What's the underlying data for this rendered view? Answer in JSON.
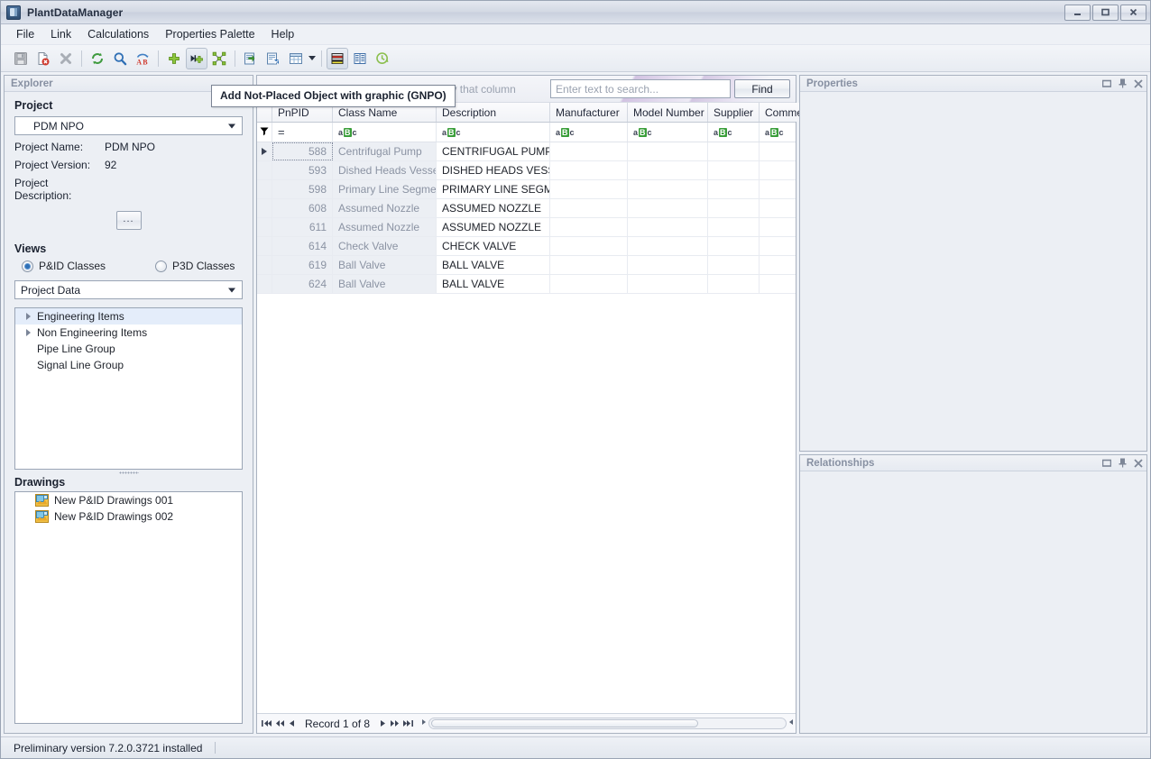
{
  "window": {
    "title": "PlantDataManager",
    "icon": "app-icon",
    "minimize_label": "Minimize",
    "maximize_label": "Maximize",
    "close_label": "Close"
  },
  "menu": {
    "items": [
      {
        "label": "File"
      },
      {
        "label": "Link"
      },
      {
        "label": "Calculations"
      },
      {
        "label": "Properties Palette"
      },
      {
        "label": "Help"
      }
    ]
  },
  "toolbar": {
    "buttons": [
      {
        "name": "save-icon",
        "tip": "Save"
      },
      {
        "name": "delete-document-icon",
        "tip": "Delete document"
      },
      {
        "name": "close-x-icon",
        "tip": "Close"
      },
      {
        "name": "refresh-icon",
        "tip": "Refresh"
      },
      {
        "name": "search-icon",
        "tip": "Search"
      },
      {
        "name": "rename-ab-icon",
        "tip": "Rename"
      },
      {
        "name": "add-plus-icon",
        "tip": "Add"
      },
      {
        "name": "add-not-placed-object-gnpo-icon",
        "tip": "Add Not-Placed Object with graphic (GNPO)"
      },
      {
        "name": "link-scatter-icon",
        "tip": "Link"
      },
      {
        "name": "export-icon",
        "tip": "Export"
      },
      {
        "name": "import-icon",
        "tip": "Import"
      },
      {
        "name": "table-layout-icon",
        "tip": "Table layout"
      },
      {
        "name": "color-bands-icon",
        "tip": "Color bands"
      },
      {
        "name": "columns-icon",
        "tip": "Columns"
      },
      {
        "name": "history-clock-icon",
        "tip": "History"
      }
    ]
  },
  "tooltip": {
    "text": "Add Not-Placed Object with graphic (GNPO)"
  },
  "explorer": {
    "title": "Explorer",
    "project_section_label": "Project",
    "project_combo_value": "PDM NPO",
    "fields": [
      {
        "label": "Project Name:",
        "value": "PDM NPO"
      },
      {
        "label": "Project Version:",
        "value": "92"
      },
      {
        "label": "Project Description:",
        "value": ""
      }
    ],
    "browse_button_label": "...",
    "views_section_label": "Views",
    "radios": [
      {
        "label": "P&ID Classes",
        "selected": true
      },
      {
        "label": "P3D Classes",
        "selected": false
      }
    ],
    "data_combo_value": "Project Data",
    "tree": [
      {
        "label": "Engineering Items",
        "expandable": true,
        "selected": true
      },
      {
        "label": "Non Engineering Items",
        "expandable": true,
        "selected": false
      },
      {
        "label": "Pipe Line Group",
        "expandable": false,
        "selected": false
      },
      {
        "label": "Signal Line Group",
        "expandable": false,
        "selected": false
      }
    ],
    "drawings_section_label": "Drawings",
    "drawings": [
      {
        "label": "New P&ID Drawings 001",
        "icon": "drawing-icon"
      },
      {
        "label": "New P&ID Drawings 002",
        "icon": "drawing-icon"
      }
    ]
  },
  "grid": {
    "group_hint": "Drag a column header here to group by that column",
    "search_placeholder": "Enter text to search...",
    "search_value": "",
    "find_label": "Find",
    "columns": [
      {
        "label": "PnPID",
        "width": 67,
        "filter": "=",
        "align": "right",
        "readonly": true
      },
      {
        "label": "Class Name",
        "width": 115,
        "filter": "abc",
        "align": "left",
        "readonly": true
      },
      {
        "label": "Description",
        "width": 126,
        "filter": "abc",
        "align": "left",
        "readonly": false
      },
      {
        "label": "Manufacturer",
        "width": 86,
        "filter": "abc",
        "align": "left",
        "readonly": false
      },
      {
        "label": "Model Number",
        "width": 89,
        "filter": "abc",
        "align": "left",
        "readonly": false
      },
      {
        "label": "Supplier",
        "width": 57,
        "filter": "abc",
        "align": "left",
        "readonly": false
      },
      {
        "label": "Comment",
        "width": 58,
        "filter": "abc",
        "align": "left",
        "readonly": false
      }
    ],
    "rows": [
      {
        "current": true,
        "PnPID": "588",
        "Class Name": "Centrifugal Pump",
        "Description": "CENTRIFUGAL PUMP",
        "Manufacturer": "",
        "Model Number": "",
        "Supplier": "",
        "Comment": ""
      },
      {
        "current": false,
        "PnPID": "593",
        "Class Name": "Dished Heads Vessel",
        "Description": "DISHED HEADS VESSEL",
        "Manufacturer": "",
        "Model Number": "",
        "Supplier": "",
        "Comment": ""
      },
      {
        "current": false,
        "PnPID": "598",
        "Class Name": "Primary Line Segment",
        "Description": "PRIMARY LINE SEGMENT",
        "Manufacturer": "",
        "Model Number": "",
        "Supplier": "",
        "Comment": ""
      },
      {
        "current": false,
        "PnPID": "608",
        "Class Name": "Assumed Nozzle",
        "Description": "ASSUMED NOZZLE",
        "Manufacturer": "",
        "Model Number": "",
        "Supplier": "",
        "Comment": ""
      },
      {
        "current": false,
        "PnPID": "611",
        "Class Name": "Assumed Nozzle",
        "Description": "ASSUMED NOZZLE",
        "Manufacturer": "",
        "Model Number": "",
        "Supplier": "",
        "Comment": ""
      },
      {
        "current": false,
        "PnPID": "614",
        "Class Name": "Check Valve",
        "Description": "CHECK VALVE",
        "Manufacturer": "",
        "Model Number": "",
        "Supplier": "",
        "Comment": ""
      },
      {
        "current": false,
        "PnPID": "619",
        "Class Name": "Ball Valve",
        "Description": "BALL VALVE",
        "Manufacturer": "",
        "Model Number": "",
        "Supplier": "",
        "Comment": ""
      },
      {
        "current": false,
        "PnPID": "624",
        "Class Name": "Ball Valve",
        "Description": "BALL VALVE",
        "Manufacturer": "",
        "Model Number": "",
        "Supplier": "",
        "Comment": ""
      }
    ],
    "nav": {
      "first_label": "First",
      "prev_page_label": "Previous page",
      "prev_label": "Previous",
      "record_text": "Record 1 of 8",
      "next_label": "Next",
      "next_page_label": "Next page",
      "last_label": "Last"
    }
  },
  "properties_panel": {
    "title": "Properties",
    "restore_label": "Restore",
    "pin_label": "Auto Hide",
    "close_label": "Close"
  },
  "relationships_panel": {
    "title": "Relationships",
    "restore_label": "Restore",
    "pin_label": "Auto Hide",
    "close_label": "Close"
  },
  "status": {
    "text": "Preliminary version 7.2.0.3721 installed"
  },
  "colors": {
    "accent_green": "#3a9e3a",
    "select_blue": "#e4edfa",
    "panel_title": "#8790a2",
    "readonly_text": "#8b93a3",
    "swoosh_purple": "#ccbade"
  }
}
